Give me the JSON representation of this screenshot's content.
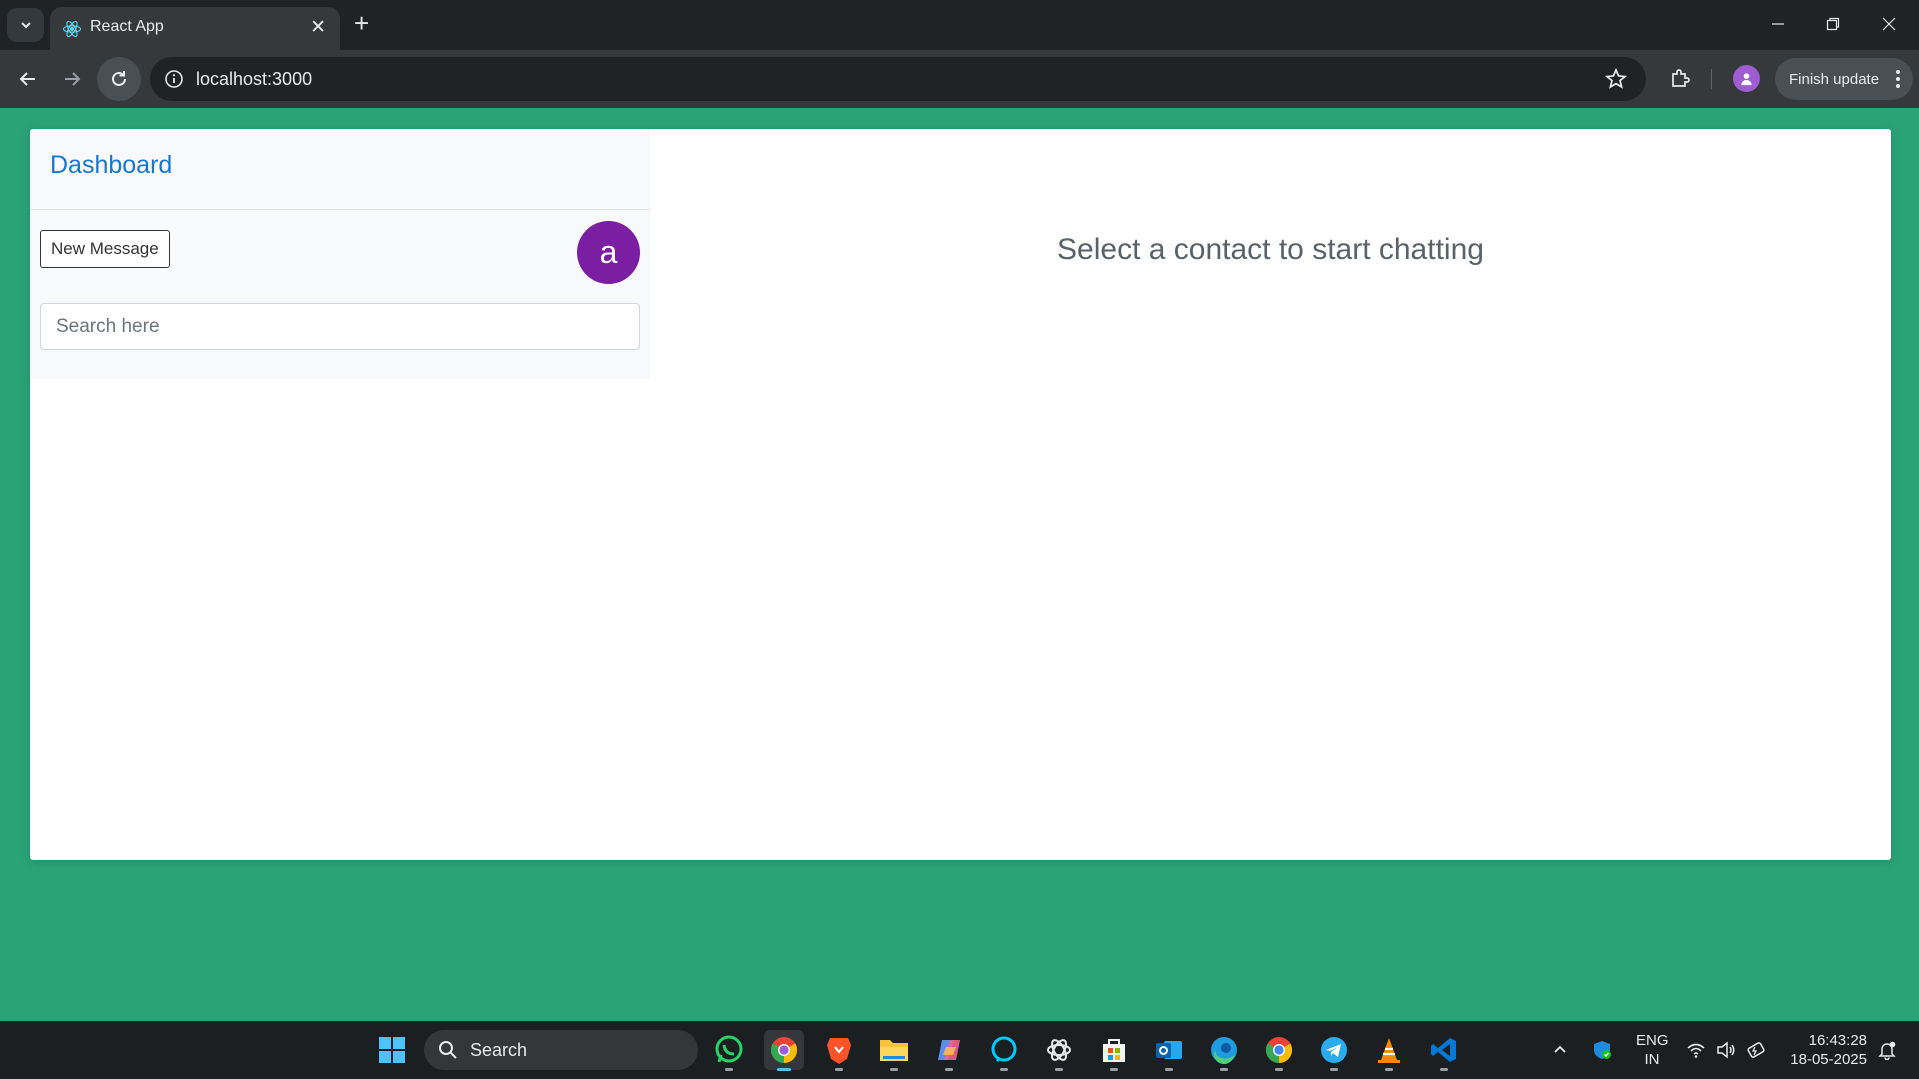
{
  "browser": {
    "tab_title": "React App",
    "url": "localhost:3000",
    "finish_update_label": "Finish update"
  },
  "app": {
    "sidebar": {
      "title": "Dashboard",
      "new_message_label": "New Message",
      "avatar_letter": "a",
      "search_placeholder": "Search here"
    },
    "chat": {
      "placeholder_text": "Select a contact to start chatting"
    }
  },
  "taskbar": {
    "search_label": "Search",
    "language": "ENG",
    "region": "IN",
    "time": "16:43:28",
    "date": "18-05-2025",
    "apps": [
      "whatsapp-icon",
      "chrome-icon",
      "brave-icon",
      "file-explorer-icon",
      "copilot-icon",
      "alexa-icon",
      "chatgpt-icon",
      "ms-store-icon",
      "outlook-icon",
      "edge-icon",
      "chrome-icon",
      "telegram-icon",
      "vlc-icon",
      "vscode-icon"
    ]
  },
  "colors": {
    "page_background": "#2ba379",
    "dashboard_title": "#1677d2",
    "avatar_background": "#7b1fa2"
  }
}
